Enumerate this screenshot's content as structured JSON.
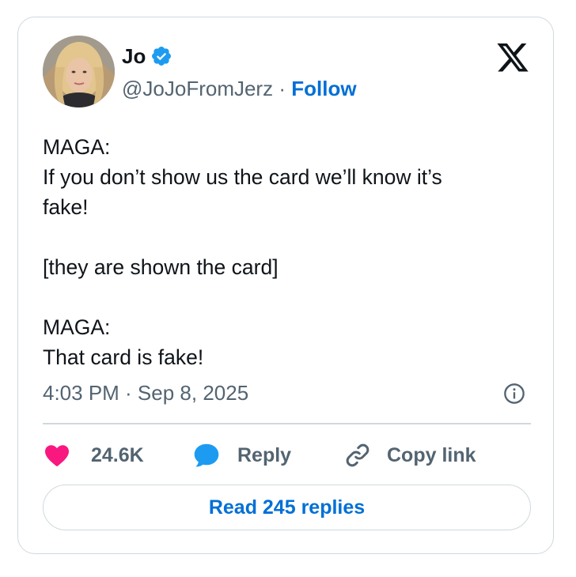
{
  "author": {
    "name": "Jo",
    "handle": "@JoJoFromJerz",
    "separator": "·",
    "follow_label": "Follow",
    "verified": true
  },
  "tweet": {
    "lines": [
      "MAGA:",
      "If you don’t show us the card we’ll know it’s",
      "fake!",
      "",
      "[they are shown the card]",
      "",
      "MAGA:",
      "That card is fake!"
    ],
    "timestamp": "4:03 PM · Sep 8, 2025"
  },
  "actions": {
    "likes": "24.6K",
    "reply_label": "Reply",
    "copy_link_label": "Copy link"
  },
  "read_replies_label": "Read 245 replies",
  "icons": {
    "verified": "verified-badge-icon",
    "x_logo": "x-logo-icon",
    "info": "info-icon",
    "like": "heart-icon",
    "reply": "speech-bubble-icon",
    "link": "link-icon"
  },
  "colors": {
    "link_blue": "#006fd6",
    "verified_blue": "#1d9bf0",
    "heart_pink": "#f91880",
    "muted_text": "#536471",
    "border": "#cfd9de"
  }
}
